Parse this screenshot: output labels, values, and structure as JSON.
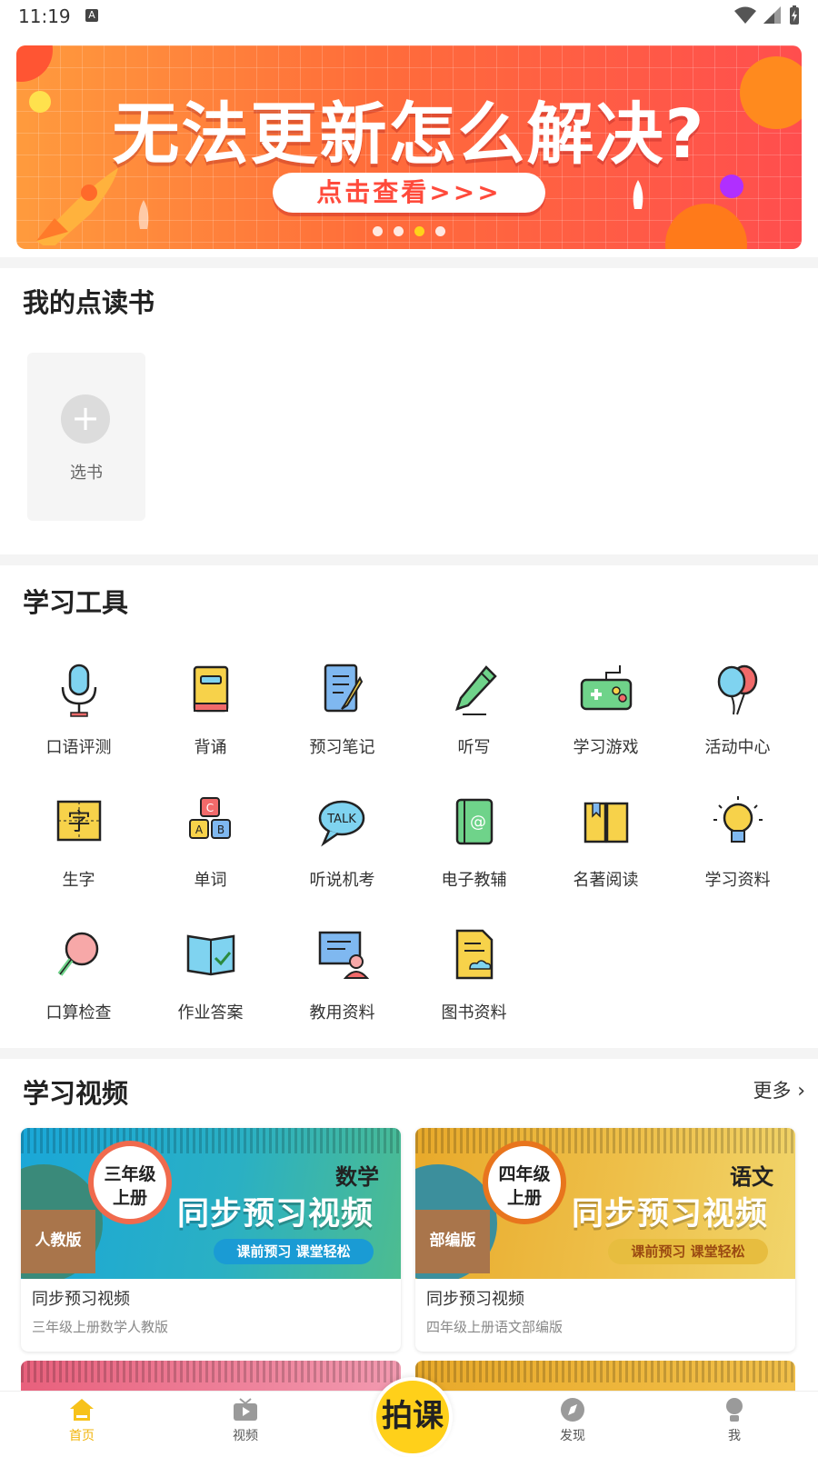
{
  "status_bar": {
    "time": "11:19",
    "notification_icon": "A"
  },
  "banner": {
    "headline": "无法更新怎么解决?",
    "cta": "点击查看>>>",
    "dots_total": 4,
    "active_dot_index": 2
  },
  "my_books": {
    "title": "我的点读书",
    "add_label": "选书"
  },
  "tools": {
    "title": "学习工具",
    "items": [
      {
        "label": "口语评测",
        "icon": "microphone-icon"
      },
      {
        "label": "背诵",
        "icon": "book-icon"
      },
      {
        "label": "预习笔记",
        "icon": "notebook-pencil-icon"
      },
      {
        "label": "听写",
        "icon": "pencil-icon"
      },
      {
        "label": "学习游戏",
        "icon": "gamepad-icon"
      },
      {
        "label": "活动中心",
        "icon": "balloons-icon"
      },
      {
        "label": "生字",
        "icon": "character-card-icon"
      },
      {
        "label": "单词",
        "icon": "abc-blocks-icon"
      },
      {
        "label": "听说机考",
        "icon": "talk-bubble-icon"
      },
      {
        "label": "电子教辅",
        "icon": "ebook-icon"
      },
      {
        "label": "名著阅读",
        "icon": "open-book-icon"
      },
      {
        "label": "学习资料",
        "icon": "lightbulb-icon"
      },
      {
        "label": "口算检查",
        "icon": "magnifier-icon"
      },
      {
        "label": "作业答案",
        "icon": "answer-book-icon"
      },
      {
        "label": "教用资料",
        "icon": "teacher-board-icon"
      },
      {
        "label": "图书资料",
        "icon": "document-cloud-icon"
      }
    ]
  },
  "videos": {
    "title": "学习视频",
    "more_label": "更多",
    "cards": [
      {
        "grade_line1": "三年级",
        "grade_line2": "上册",
        "subject": "数学",
        "video_title": "同步预习视频",
        "slogan": "课前预习 课堂轻松",
        "edition": "人教版",
        "title": "同步预习视频",
        "subtitle": "三年级上册数学人教版",
        "theme": "#2aa8c9",
        "accent": "#4fb58b",
        "slogan_bg": "#1a9bd4",
        "slogan_color": "#ffffff",
        "ring": "#f06a4d"
      },
      {
        "grade_line1": "四年级",
        "grade_line2": "上册",
        "subject": "语文",
        "video_title": "同步预习视频",
        "slogan": "课前预习 课堂轻松",
        "edition": "部编版",
        "title": "同步预习视频",
        "subtitle": "四年级上册语文部编版",
        "theme": "#e9b53a",
        "accent": "#f1d46b",
        "slogan_bg": "#e7bd3f",
        "slogan_color": "#9a4a12",
        "ring": "#e8751d"
      }
    ]
  },
  "bottom_nav": {
    "items": [
      {
        "label": "首页",
        "icon": "home-icon",
        "active": true
      },
      {
        "label": "视频",
        "icon": "tv-icon",
        "active": false
      },
      {
        "label": "发现",
        "icon": "compass-icon",
        "active": false
      },
      {
        "label": "我",
        "icon": "profile-icon",
        "active": false
      }
    ],
    "center_label": "拍课"
  }
}
